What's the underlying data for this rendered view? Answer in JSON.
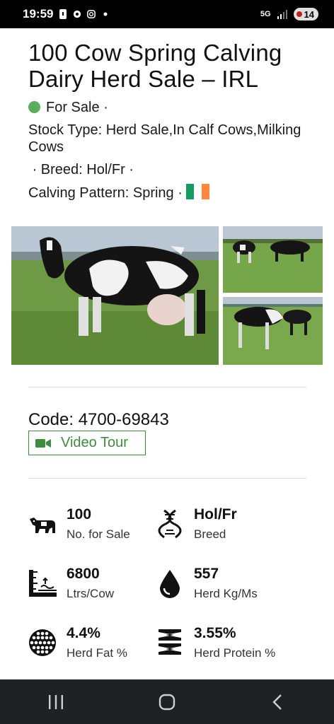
{
  "status_bar": {
    "time": "19:59",
    "network": "5G",
    "battery": "14"
  },
  "listing": {
    "title": "100 Cow Spring Calving Dairy Herd Sale – IRL",
    "status": "For Sale",
    "separator": "·",
    "stock_type": "Stock Type: Herd Sale,In Calf Cows,Milking Cows",
    "breed": "Breed: Hol/Fr",
    "calving_pattern": "Calving Pattern: Spring",
    "status_color": "#5aad5a",
    "flag_colors": [
      "#169b62",
      "#ffffff",
      "#ff883e"
    ]
  },
  "code": "Code: 4700-69843",
  "video_tour": "Video Tour",
  "stats": [
    {
      "value": "100",
      "label": "No. for Sale",
      "icon": "cow-icon"
    },
    {
      "value": "Hol/Fr",
      "label": "Breed",
      "icon": "dna-icon"
    },
    {
      "value": "6800",
      "label": "Ltrs/Cow",
      "icon": "measure-icon"
    },
    {
      "value": "557",
      "label": "Herd Kg/Ms",
      "icon": "drop-icon"
    },
    {
      "value": "4.4%",
      "label": "Herd Fat %",
      "icon": "fat-globules-icon"
    },
    {
      "value": "3.55%",
      "label": "Herd Protein %",
      "icon": "protein-icon"
    }
  ],
  "accent": "#3e8d3e"
}
